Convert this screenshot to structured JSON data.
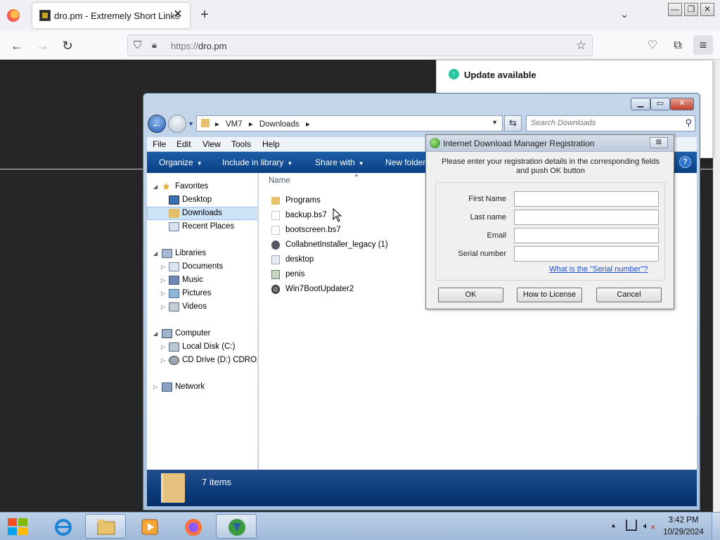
{
  "browser": {
    "tab_title": "dro.pm - Extremely Short Links",
    "tab_close": "✕",
    "new_tab": "+",
    "list_all_tabs": "⌄",
    "url_scheme": "https://",
    "url_host": "dro.pm",
    "update_panel": {
      "title": "Update available"
    }
  },
  "explorer": {
    "breadcrumbs": [
      "VM7",
      "Downloads"
    ],
    "search_placeholder": "Search Downloads",
    "menu": [
      "File",
      "Edit",
      "View",
      "Tools",
      "Help"
    ],
    "commands": [
      "Organize",
      "Include in library",
      "Share with",
      "New folder"
    ],
    "column_name": "Name",
    "nav": [
      {
        "label": "Favorites",
        "level": 0,
        "icon": "star-icon",
        "expanded": true
      },
      {
        "label": "Desktop",
        "level": 1,
        "icon": "desktop-icon"
      },
      {
        "label": "Downloads",
        "level": 1,
        "icon": "downloads-folder-icon",
        "selected": true
      },
      {
        "label": "Recent Places",
        "level": 1,
        "icon": "recent-places-icon"
      },
      {
        "label": "Libraries",
        "level": 0,
        "icon": "libraries-icon",
        "expanded": true
      },
      {
        "label": "Documents",
        "level": 1,
        "icon": "documents-icon"
      },
      {
        "label": "Music",
        "level": 1,
        "icon": "music-icon"
      },
      {
        "label": "Pictures",
        "level": 1,
        "icon": "pictures-icon"
      },
      {
        "label": "Videos",
        "level": 1,
        "icon": "videos-icon"
      },
      {
        "label": "Computer",
        "level": 0,
        "icon": "computer-icon",
        "expanded": true
      },
      {
        "label": "Local Disk (C:)",
        "level": 1,
        "icon": "local-disk-icon"
      },
      {
        "label": "CD Drive (D:) CDROM",
        "level": 1,
        "icon": "cd-drive-icon"
      },
      {
        "label": "Network",
        "level": 0,
        "icon": "network-icon"
      }
    ],
    "files": [
      {
        "name": "Programs",
        "icon": "folder-icon"
      },
      {
        "name": "backup.bs7",
        "icon": "blank-file-icon"
      },
      {
        "name": "bootscreen.bs7",
        "icon": "blank-file-icon"
      },
      {
        "name": "CollabnetInstaller_legacy (1)",
        "icon": "installer-icon"
      },
      {
        "name": "desktop",
        "icon": "settings-file-icon"
      },
      {
        "name": "penis",
        "icon": "image-file-icon"
      },
      {
        "name": "Win7BootUpdater2",
        "icon": "app-icon"
      }
    ],
    "status_text": "7 items"
  },
  "idm_dialog": {
    "title": "Internet Download Manager Registration",
    "close": "⊠",
    "instructions": "Please enter your registration details in the corresponding fields and push OK button",
    "fields": [
      {
        "label": "First Name",
        "value": ""
      },
      {
        "label": "Last name",
        "value": ""
      },
      {
        "label": "Email",
        "value": ""
      },
      {
        "label": "Serial number",
        "value": ""
      }
    ],
    "serial_link": "What is the \"Serial number\"?",
    "buttons": {
      "ok": "OK",
      "how": "How to License",
      "cancel": "Cancel"
    }
  },
  "taskbar": {
    "time": "3:42 PM",
    "date": "10/29/2024",
    "pinned": [
      "internet-explorer-icon",
      "windows-explorer-icon",
      "media-player-icon",
      "firefox-icon",
      "idm-icon"
    ]
  }
}
